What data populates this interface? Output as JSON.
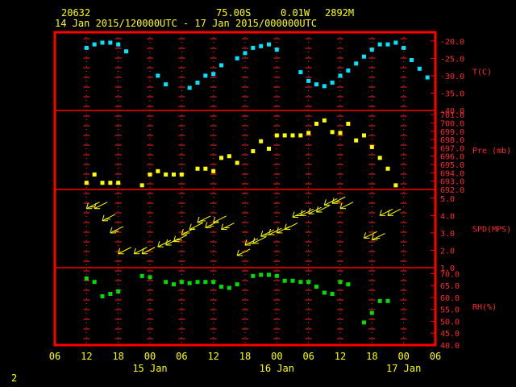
{
  "header": {
    "station": "20632",
    "lat": "75.00S",
    "lon": "0.01W",
    "elev": "2892M",
    "range": "14 Jan 2015/120000UTC - 17 Jan 2015/000000UTC"
  },
  "footer_label": "2",
  "colors": {
    "frame": "#ff0000",
    "grid": "#ff2020",
    "text": "#ffff00",
    "temp": "#00e5ff",
    "pres": "#ffff00",
    "wind": "#ffff00",
    "rh": "#00dd00"
  },
  "chart_data": {
    "type": "scatter",
    "x_axis": {
      "range_hours": [
        -6,
        54
      ],
      "tick_labels": [
        {
          "h": -6,
          "label": "06"
        },
        {
          "h": 0,
          "label": "12"
        },
        {
          "h": 6,
          "label": "18"
        },
        {
          "h": 12,
          "label": "00"
        },
        {
          "h": 18,
          "label": "06"
        },
        {
          "h": 24,
          "label": "12"
        },
        {
          "h": 30,
          "label": "18"
        },
        {
          "h": 36,
          "label": "00"
        },
        {
          "h": 42,
          "label": "06"
        },
        {
          "h": 48,
          "label": "12"
        },
        {
          "h": 54,
          "label": "18"
        },
        {
          "h": 60,
          "label": "00"
        },
        {
          "h": 66,
          "label": "06"
        }
      ],
      "day_labels": [
        {
          "h": 12,
          "label": "15 Jan"
        },
        {
          "h": 36,
          "label": "16 Jan"
        },
        {
          "h": 60,
          "label": "17 Jan"
        }
      ]
    },
    "panels": [
      {
        "key": "temp",
        "label": "T(C)",
        "ylim": [
          -40,
          -17.5
        ],
        "ticks": [
          "-20.0",
          "-25.0",
          "-30.0",
          "-35.0",
          "-40.0"
        ],
        "tick_values": [
          -20,
          -25,
          -30,
          -35,
          -40
        ],
        "points": [
          [
            0,
            -22
          ],
          [
            1.5,
            -21
          ],
          [
            3,
            -20.5
          ],
          [
            4.5,
            -20.5
          ],
          [
            6,
            -21
          ],
          [
            7.5,
            -23
          ],
          [
            13.5,
            -30
          ],
          [
            15,
            -32.5
          ],
          [
            19.5,
            -33.5
          ],
          [
            21,
            -32
          ],
          [
            22.5,
            -30
          ],
          [
            24,
            -29.5
          ],
          [
            25.5,
            -27
          ],
          [
            28.5,
            -25
          ],
          [
            30,
            -23.5
          ],
          [
            31.5,
            -22
          ],
          [
            33,
            -21.5
          ],
          [
            34.5,
            -21
          ],
          [
            36,
            -22.5
          ],
          [
            40.5,
            -29
          ],
          [
            42,
            -31.5
          ],
          [
            43.5,
            -32.5
          ],
          [
            45,
            -33
          ],
          [
            46.5,
            -32
          ],
          [
            48,
            -30
          ],
          [
            49.5,
            -28.5
          ],
          [
            51,
            -26.5
          ],
          [
            52.5,
            -24.5
          ],
          [
            54,
            -22.5
          ],
          [
            55.5,
            -21
          ],
          [
            57,
            -21
          ],
          [
            58.5,
            -20.5
          ],
          [
            60,
            -22
          ],
          [
            61.5,
            -25.5
          ],
          [
            63,
            -28
          ],
          [
            64.5,
            -30.5
          ]
        ]
      },
      {
        "key": "pres",
        "label": "Pre (mb)",
        "ylim": [
          692,
          701.5
        ],
        "ticks": [
          "701.0",
          "700.0",
          "699.0",
          "698.0",
          "697.0",
          "696.0",
          "695.0",
          "694.0",
          "693.0",
          "692.0"
        ],
        "tick_values": [
          701,
          700,
          699,
          698,
          697,
          696,
          695,
          694,
          693,
          692
        ],
        "points": [
          [
            0,
            692.8
          ],
          [
            1.5,
            693.8
          ],
          [
            3,
            692.8
          ],
          [
            4.5,
            692.8
          ],
          [
            6,
            692.8
          ],
          [
            10.5,
            692.5
          ],
          [
            12,
            693.8
          ],
          [
            13.5,
            694.2
          ],
          [
            15,
            693.8
          ],
          [
            16.5,
            693.8
          ],
          [
            18,
            693.8
          ],
          [
            21,
            694.5
          ],
          [
            22.5,
            694.5
          ],
          [
            24,
            694.2
          ],
          [
            25.5,
            695.8
          ],
          [
            27,
            696
          ],
          [
            28.5,
            695.2
          ],
          [
            31.5,
            696.6
          ],
          [
            33,
            697.8
          ],
          [
            34.5,
            696.9
          ],
          [
            36,
            698.5
          ],
          [
            37.5,
            698.5
          ],
          [
            39,
            698.5
          ],
          [
            40.5,
            698.5
          ],
          [
            42,
            698.8
          ],
          [
            43.5,
            699.9
          ],
          [
            45,
            700.3
          ],
          [
            46.5,
            698.9
          ],
          [
            48,
            698.8
          ],
          [
            49.5,
            699.9
          ],
          [
            51,
            697.9
          ],
          [
            52.5,
            698.5
          ],
          [
            54,
            697.1
          ],
          [
            55.5,
            695.8
          ],
          [
            57,
            694.5
          ],
          [
            58.5,
            692.5
          ]
        ]
      },
      {
        "key": "wind",
        "label": "SPD(MPS)",
        "ylim": [
          1,
          5.5
        ],
        "ticks": [
          "5.0",
          "4.0",
          "3.0",
          "2.0",
          "1.0"
        ],
        "tick_values": [
          5,
          4,
          3,
          2,
          1
        ],
        "points": [
          [
            0,
            4.4,
            2
          ],
          [
            1.5,
            4.4,
            1
          ],
          [
            3,
            3.7,
            2
          ],
          [
            4.5,
            3,
            2
          ],
          [
            6,
            1.8,
            1
          ],
          [
            9,
            1.8,
            1
          ],
          [
            10.5,
            1.8,
            1
          ],
          [
            13.5,
            2.2,
            1
          ],
          [
            15,
            2.3,
            1
          ],
          [
            16.5,
            2.5,
            2
          ],
          [
            18,
            2.9,
            2
          ],
          [
            19.5,
            3.2,
            1
          ],
          [
            21,
            3.6,
            2
          ],
          [
            22.5,
            3.3,
            2
          ],
          [
            24,
            3.6,
            1
          ],
          [
            25.5,
            3.2,
            2
          ],
          [
            28.5,
            1.7,
            1
          ],
          [
            30,
            2.3,
            2
          ],
          [
            31.5,
            2.4,
            1
          ],
          [
            33,
            2.8,
            2
          ],
          [
            34.5,
            2.9,
            1
          ],
          [
            36,
            3,
            1
          ],
          [
            37.5,
            3.2,
            1
          ],
          [
            39,
            3.9,
            2
          ],
          [
            40.5,
            4,
            1
          ],
          [
            42,
            4.1,
            1
          ],
          [
            43.5,
            4.2,
            1
          ],
          [
            45,
            4.6,
            1
          ],
          [
            46.5,
            4.7,
            2
          ],
          [
            48,
            4.4,
            1
          ],
          [
            52.5,
            2.7,
            1
          ],
          [
            54,
            2.6,
            2
          ],
          [
            55.5,
            4,
            1
          ],
          [
            57,
            4,
            1
          ]
        ]
      },
      {
        "key": "rh",
        "label": "RH(%)",
        "ylim": [
          40,
          72.5
        ],
        "ticks": [
          "70.0",
          "65.0",
          "60.0",
          "55.0",
          "50.0",
          "45.0",
          "40.0"
        ],
        "tick_values": [
          70,
          65,
          60,
          55,
          50,
          45,
          40
        ],
        "points": [
          [
            0,
            68
          ],
          [
            1.5,
            66.5
          ],
          [
            3,
            60.5
          ],
          [
            4.5,
            61.5
          ],
          [
            6,
            62.5
          ],
          [
            10.5,
            69
          ],
          [
            12,
            68.5
          ],
          [
            15,
            66.5
          ],
          [
            16.5,
            65.5
          ],
          [
            18,
            66.5
          ],
          [
            19.5,
            66
          ],
          [
            21,
            66.5
          ],
          [
            22.5,
            66.5
          ],
          [
            24,
            66.5
          ],
          [
            25.5,
            64.5
          ],
          [
            27,
            64
          ],
          [
            28.5,
            65.5
          ],
          [
            31.5,
            69
          ],
          [
            33,
            69.5
          ],
          [
            34.5,
            69.5
          ],
          [
            36,
            69
          ],
          [
            37.5,
            67
          ],
          [
            39,
            67
          ],
          [
            40.5,
            66.5
          ],
          [
            42,
            66.5
          ],
          [
            43.5,
            64.5
          ],
          [
            45,
            62
          ],
          [
            46.5,
            61.5
          ],
          [
            48,
            66.5
          ],
          [
            49.5,
            65.5
          ],
          [
            52.5,
            49.5
          ],
          [
            54,
            53.5
          ],
          [
            55.5,
            58.5
          ],
          [
            57,
            58.5
          ]
        ]
      }
    ]
  }
}
